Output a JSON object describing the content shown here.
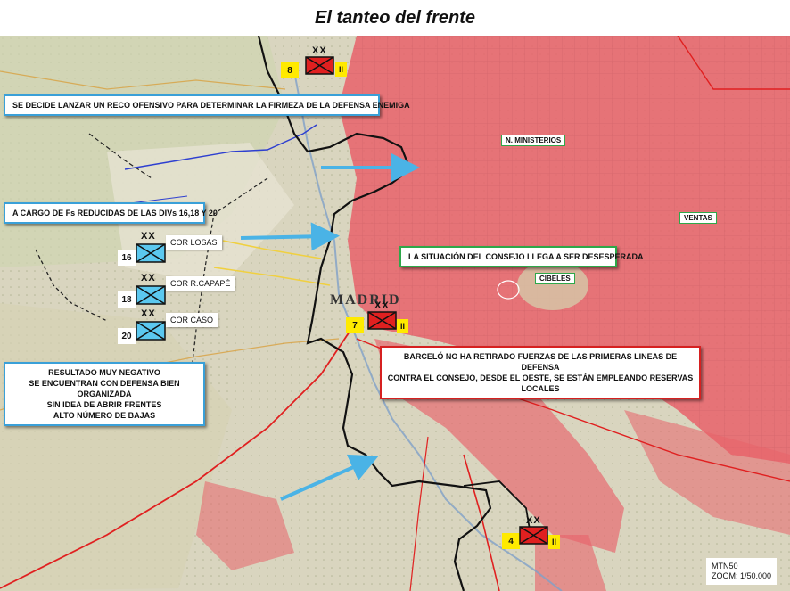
{
  "title": "El tanteo del frente",
  "notes": {
    "reco": "SE DECIDE LANZAR UN RECO OFENSIVO  PARA DETERMINAR LA FIRMEZA DE LA DEFENSA ENEMIGA",
    "cargo": "A CARGO DE Fs REDUCIDAS DE LAS DIVs 16,18 Y 20",
    "situacion": "LA SITUACIÓN DEL CONSEJO LLEGA A SER DESESPERADA",
    "barcelo_1": "BARCELÓ NO HA RETIRADO FUERZAS DE LAS PRIMERAS  LINEAS DE DEFENSA",
    "barcelo_2": "CONTRA EL CONSEJO, DESDE EL OESTE,  SE ESTÁN EMPLEANDO RESERVAS LOCALES",
    "resultado_1": "RESULTADO MUY NEGATIVO",
    "resultado_2": "SE ENCUENTRAN CON DEFENSA BIEN ORGANIZADA",
    "resultado_3": "SIN IDEA DE ABRIR FRENTES",
    "resultado_4": "ALTO NÚMERO DE BAJAS"
  },
  "units": {
    "friendly": [
      {
        "number": "16",
        "corps": "COR LOSAS",
        "echelon": "XX"
      },
      {
        "number": "18",
        "corps": "COR R.CAPAPÉ",
        "echelon": "XX"
      },
      {
        "number": "20",
        "corps": "COR CASO",
        "echelon": "XX"
      }
    ],
    "enemy": [
      {
        "number": "8",
        "size": "II",
        "echelon": "XX"
      },
      {
        "number": "7",
        "size": "II",
        "echelon": "XX"
      },
      {
        "number": "4",
        "size": "II",
        "echelon": "XX"
      }
    ]
  },
  "map_labels": {
    "ministerios": "N. MINISTERIOS",
    "ventas": "VENTAS",
    "cibeles": "CIBELES",
    "madrid": "MADRID"
  },
  "scale": {
    "source": "MTN50",
    "zoom": "ZOOM: 1/50.000"
  },
  "colors": {
    "friendly_fill": "#5bc8ef",
    "enemy_fill": "#e02020",
    "advance_arrow": "#4ab3e6",
    "city": "#e8626a"
  }
}
